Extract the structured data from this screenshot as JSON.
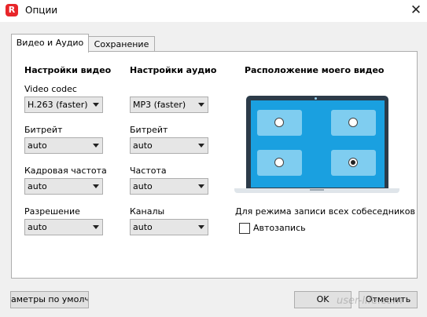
{
  "window": {
    "title": "Опции",
    "app_icon_letter": "R",
    "close_glyph": "✕"
  },
  "tabs": [
    {
      "label": "Видео и Аудио",
      "active": true
    },
    {
      "label": "Сохранение",
      "active": false
    }
  ],
  "video": {
    "heading": "Настройки видео",
    "codec_label": "Video codec",
    "codec_value": "H.263 (faster)",
    "bitrate_label": "Битрейт",
    "bitrate_value": "auto",
    "framerate_label": "Кадровая частота",
    "framerate_value": "auto",
    "resolution_label": "Разрешение",
    "resolution_value": "auto"
  },
  "audio": {
    "heading": "Настройки аудио",
    "codec_value": "MP3 (faster)",
    "bitrate_label": "Битрейт",
    "bitrate_value": "auto",
    "frequency_label": "Частота",
    "frequency_value": "auto",
    "channels_label": "Каналы",
    "channels_value": "auto"
  },
  "position": {
    "heading": "Расположение моего видео",
    "selected": "bottom-right",
    "accent_color": "#1aa0e0",
    "record_all_label": "Для режима записи всех собеседников",
    "autorecord_label": "Автозапись",
    "autorecord_checked": false
  },
  "footer": {
    "defaults_label": "аметры по умолчан",
    "ok_label": "OK",
    "cancel_label": "Отменить",
    "watermark": "user-life.com"
  }
}
